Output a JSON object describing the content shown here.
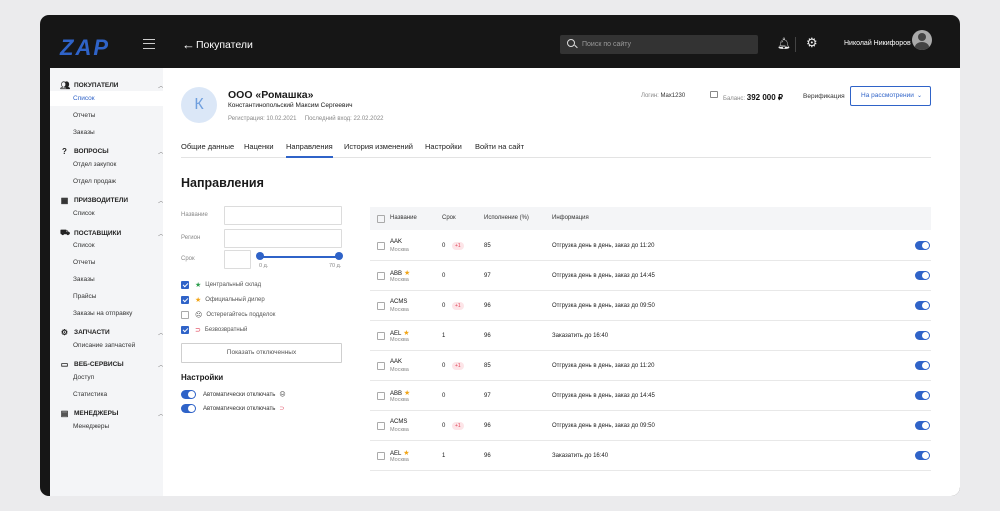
{
  "header": {
    "logo": "ZAP",
    "page_title": "Покупатели",
    "search_placeholder": "Поиск по сайту",
    "user_name": "Николай Никифоров"
  },
  "sidebar": {
    "sections": [
      {
        "title": "ПОКУПАТЕЛИ",
        "icon": "users-icon",
        "items": [
          "Список",
          "Отчеты",
          "Заказы"
        ]
      },
      {
        "title": "ВОПРОСЫ",
        "icon": "question-icon",
        "items": [
          "Отдел закупок",
          "Отдел продаж"
        ]
      },
      {
        "title": "ПРИЗВОДИТЕЛИ",
        "icon": "factory-icon",
        "items": [
          "Список"
        ]
      },
      {
        "title": "ПОСТАВЩИКИ",
        "icon": "truck-icon",
        "items": [
          "Список",
          "Отчеты",
          "Заказы",
          "Прайсы",
          "Заказы на отправку"
        ]
      },
      {
        "title": "ЗАПЧАСТИ",
        "icon": "parts-icon",
        "items": [
          "Описание запчастей"
        ]
      },
      {
        "title": "ВЕБ-СЕРВИСЫ",
        "icon": "monitor-icon",
        "items": [
          "Доступ",
          "Статистика"
        ]
      },
      {
        "title": "МЕНЕДЖЕРЫ",
        "icon": "id-card-icon",
        "items": [
          "Менеджеры"
        ]
      }
    ]
  },
  "company": {
    "avatar_letter": "К",
    "name": "ООО «Ромашка»",
    "person": "Константинопольский Максим Сергеевич",
    "registration": "Регистрация: 10.02.2021",
    "last_login": "Последний вход: 22.02.2022",
    "login_label": "Логин:",
    "login_value": "Max1230",
    "balance_label": "Баланс:",
    "balance_value": "392 000 ₽",
    "verification_label": "Верификация",
    "verification_status": "На рассмотрении"
  },
  "tabs": [
    "Общие данные",
    "Наценки",
    "Направления",
    "История изменений",
    "Настройки",
    "Войти на сайт"
  ],
  "section_title": "Направления",
  "filters": {
    "name_label": "Название",
    "region_label": "Регион",
    "term_label": "Срок",
    "slider_min": "0 д.",
    "slider_max": "70 д.",
    "checks": [
      {
        "label": "Центральный склад",
        "checked": true,
        "icon": "★",
        "icon_color": "#2e9e4e"
      },
      {
        "label": "Официальный дилер",
        "checked": true,
        "icon": "★",
        "icon_color": "#f2a516"
      },
      {
        "label": "Остерегайтесь подделок",
        "checked": false,
        "icon": "☹",
        "icon_color": "#555"
      },
      {
        "label": "Безвозвратный",
        "checked": true,
        "icon": "⊃",
        "icon_color": "#e0445a"
      }
    ],
    "show_disabled_button": "Показать отключенных"
  },
  "settings": {
    "title": "Настройки",
    "items": [
      {
        "label": "Автоматически отключать",
        "icon": "☹"
      },
      {
        "label": "Автоматически отключать",
        "icon": "⊃"
      }
    ]
  },
  "table": {
    "columns": [
      "Название",
      "Срок",
      "Исполнение (%)",
      "Информация"
    ],
    "rows": [
      {
        "name": "AAK",
        "star": false,
        "city": "Москва",
        "term": "0",
        "badge": "+1",
        "exec": "85",
        "info": "Отгрузка день в день, заказ до 11:20"
      },
      {
        "name": "ABB",
        "star": true,
        "city": "Москва",
        "term": "0",
        "badge": "",
        "exec": "97",
        "info": "Отгрузка день в день, заказ до 14:45"
      },
      {
        "name": "ACMS",
        "star": false,
        "city": "Москва",
        "term": "0",
        "badge": "+1",
        "exec": "96",
        "info": "Отгрузка день в день, заказ до 09:50"
      },
      {
        "name": "AEL",
        "star": true,
        "city": "Москва",
        "term": "1",
        "badge": "",
        "exec": "96",
        "info": "Заказатить до 16:40"
      },
      {
        "name": "AAK",
        "star": false,
        "city": "Москва",
        "term": "0",
        "badge": "+1",
        "exec": "85",
        "info": "Отгрузка день в день, заказ до 11:20"
      },
      {
        "name": "ABB",
        "star": true,
        "city": "Москва",
        "term": "0",
        "badge": "",
        "exec": "97",
        "info": "Отгрузка день в день, заказ до 14:45"
      },
      {
        "name": "ACMS",
        "star": false,
        "city": "Москва",
        "term": "0",
        "badge": "+1",
        "exec": "96",
        "info": "Отгрузка день в день, заказ до 09:50"
      },
      {
        "name": "AEL",
        "star": true,
        "city": "Москва",
        "term": "1",
        "badge": "",
        "exec": "96",
        "info": "Заказатить до 16:40"
      }
    ]
  },
  "colors": {
    "accent": "#2f63c8",
    "star": "#f2a516",
    "badge": "#e0445a",
    "topbar": "#161616"
  }
}
